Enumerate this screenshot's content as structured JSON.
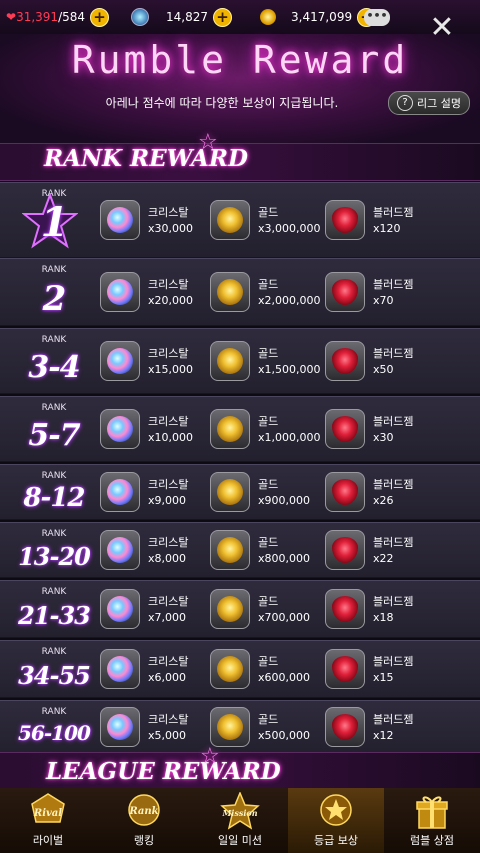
{
  "topbar": {
    "hearts": "31,391",
    "hearts_max": "/584",
    "crystals": "14,827",
    "gold": "3,417,099"
  },
  "header": {
    "title": "Rumble Reward",
    "subtitle": "아레나 점수에 따라 다양한 보상이 지급됩니다.",
    "help_label": "리그 설명"
  },
  "sections": {
    "rank_title": "RANK REWARD",
    "league_title": "LEAGUE REWARD"
  },
  "rank_label": "RANK",
  "item_names": {
    "crystal": "크리스탈",
    "gold": "골드",
    "gem": "블러드젬"
  },
  "ranks": [
    {
      "rank": "1",
      "crystal": "x30,000",
      "gold": "x3,000,000",
      "gem": "x120"
    },
    {
      "rank": "2",
      "crystal": "x20,000",
      "gold": "x2,000,000",
      "gem": "x70"
    },
    {
      "rank": "3-4",
      "crystal": "x15,000",
      "gold": "x1,500,000",
      "gem": "x50"
    },
    {
      "rank": "5-7",
      "crystal": "x10,000",
      "gold": "x1,000,000",
      "gem": "x30"
    },
    {
      "rank": "8-12",
      "crystal": "x9,000",
      "gold": "x900,000",
      "gem": "x26"
    },
    {
      "rank": "13-20",
      "crystal": "x8,000",
      "gold": "x800,000",
      "gem": "x22"
    },
    {
      "rank": "21-33",
      "crystal": "x7,000",
      "gold": "x700,000",
      "gem": "x18"
    },
    {
      "rank": "34-55",
      "crystal": "x6,000",
      "gold": "x600,000",
      "gem": "x15"
    },
    {
      "rank": "56-100",
      "crystal": "x5,000",
      "gold": "x500,000",
      "gem": "x12"
    }
  ],
  "nav": [
    {
      "label": "라이벌",
      "emblem": "Rival"
    },
    {
      "label": "랭킹",
      "emblem": "Rank"
    },
    {
      "label": "일일 미션",
      "emblem": "Mission"
    },
    {
      "label": "등급 보상",
      "emblem": "star-badge"
    },
    {
      "label": "럼블 상점",
      "emblem": "gift-box"
    }
  ],
  "colors": {
    "accent": "#ff40e0",
    "gold": "#f0b400",
    "gem": "#c8102e"
  }
}
